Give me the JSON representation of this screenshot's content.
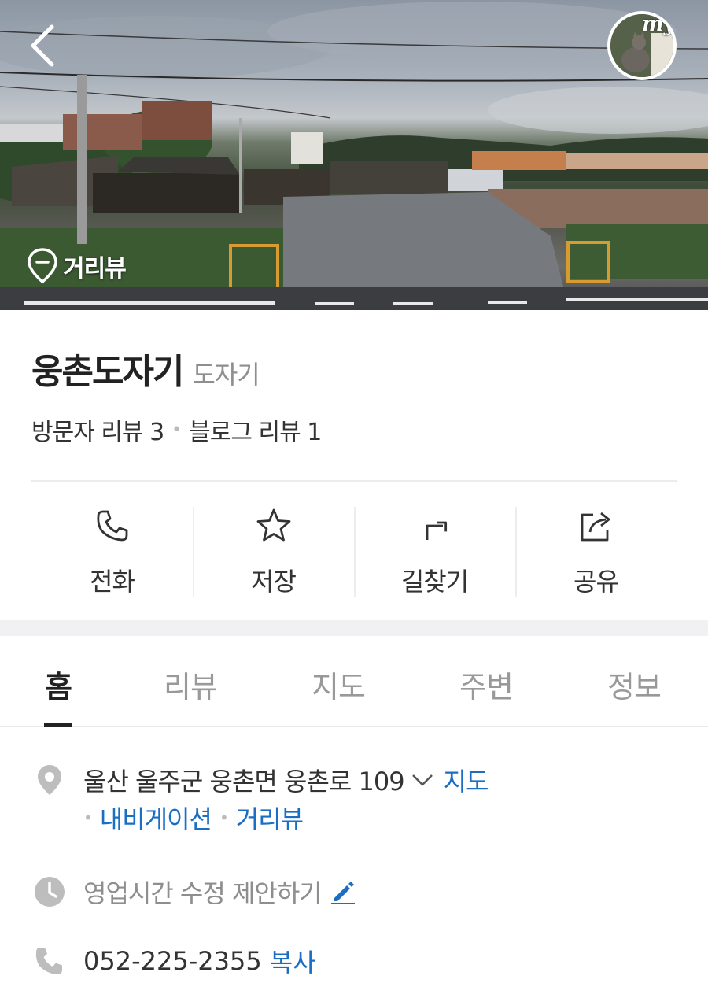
{
  "header": {
    "streetview_label": "거리뷰",
    "my_label": "my"
  },
  "place": {
    "name": "웅촌도자기",
    "category": "도자기",
    "visitor_review": "방문자 리뷰 3",
    "blog_review": "블로그 리뷰 1"
  },
  "actions": {
    "call": "전화",
    "save": "저장",
    "directions": "길찾기",
    "share": "공유"
  },
  "tabs": [
    "홈",
    "리뷰",
    "지도",
    "주변",
    "정보"
  ],
  "info": {
    "address": "울산 울주군 웅촌면 웅촌로 109",
    "map_link": "지도",
    "navigation_link": "내비게이션",
    "streetview_link": "거리뷰",
    "hours_suggest": "영업시간 수정 제안하기",
    "phone": "052-225-2355",
    "copy_label": "복사"
  },
  "colors": {
    "link_blue": "#1b6ec2",
    "muted_gray": "#8e8e8e"
  }
}
